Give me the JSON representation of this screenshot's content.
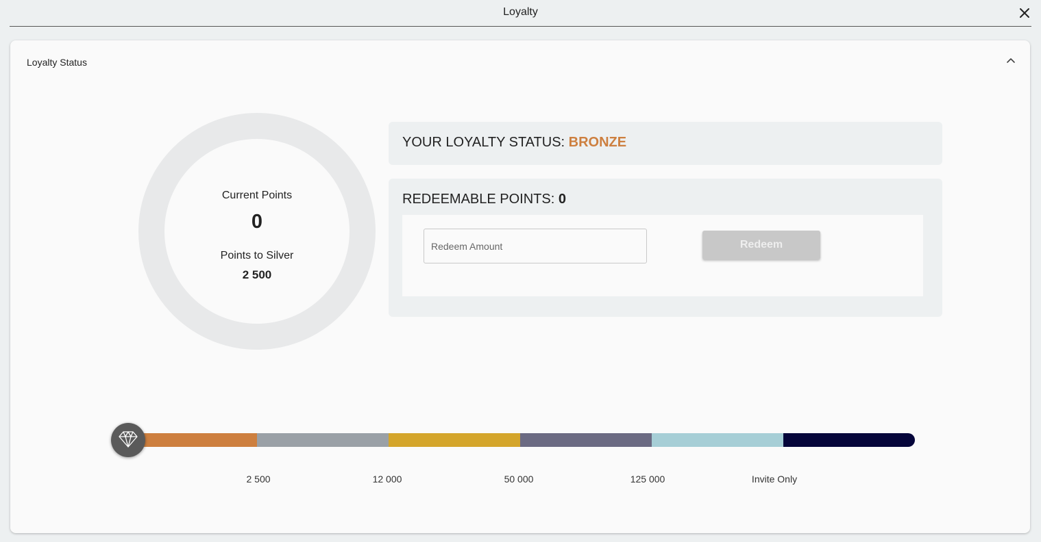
{
  "window": {
    "title": "Loyalty",
    "close_icon": "close-icon"
  },
  "section": {
    "title": "Loyalty Status",
    "collapse_icon": "chevron-up-icon"
  },
  "points_ring": {
    "current_label": "Current Points",
    "current_value": "0",
    "next_label": "Points to Silver",
    "next_value": "2 500"
  },
  "status": {
    "prefix": "YOUR LOYALTY STATUS: ",
    "tier": "BRONZE",
    "tier_color": "#cd7f3f"
  },
  "redeem": {
    "prefix": "REDEEMABLE POINTS: ",
    "points": "0",
    "input_placeholder": "Redeem Amount",
    "input_value": "",
    "button_label": "Redeem",
    "button_enabled": false
  },
  "tier_scale": {
    "marker_icon": "diamond-icon",
    "segments": [
      {
        "color": "#cd7f3f"
      },
      {
        "color": "#9aa0a6"
      },
      {
        "color": "#d4a52b"
      },
      {
        "color": "#6b6a82"
      },
      {
        "color": "#a6ced6"
      },
      {
        "color": "#05053a"
      }
    ],
    "thresholds": [
      "2 500",
      "12 000",
      "50 000",
      "125 000",
      "Invite Only"
    ]
  }
}
